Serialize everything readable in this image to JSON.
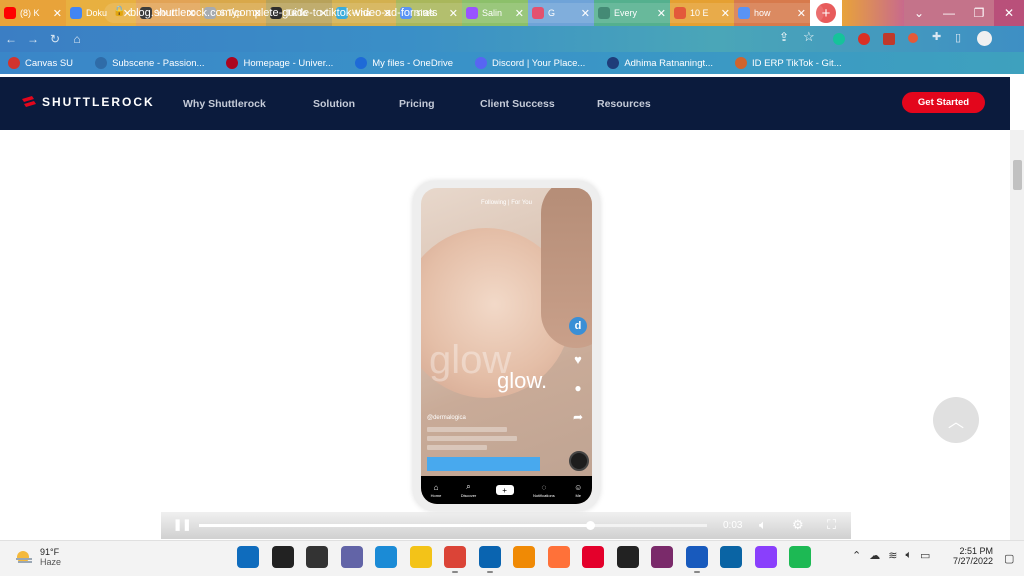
{
  "browser": {
    "tabs": [
      {
        "label": "(8) K",
        "icon": "youtube-icon",
        "color": "#e8a33a",
        "favicon_color": "#ff0000"
      },
      {
        "label": "Doku",
        "icon": "docs-icon",
        "color": "#e8b040",
        "favicon_color": "#4285f4"
      },
      {
        "label": "Your",
        "icon": "notion-icon",
        "color": "#e2a356",
        "favicon_color": "#222222"
      },
      {
        "label": "6 Typ",
        "icon": "page-icon",
        "color": "#d9a84a",
        "favicon_color": "#9aa0a6"
      },
      {
        "label": "TikTo",
        "icon": "tiktok-icon",
        "color": "#b8a25a",
        "favicon_color": "#111111"
      },
      {
        "label": "Wha",
        "icon": "canva-icon",
        "color": "#d3b04f",
        "favicon_color": "#1fa1d6"
      },
      {
        "label": "sites",
        "icon": "google-icon",
        "color": "#a9b75b",
        "favicon_color": "#4285f4"
      },
      {
        "label": "Salin",
        "icon": "canva-icon",
        "color": "#8cc06a",
        "favicon_color": "#8b3dff"
      },
      {
        "label": "G",
        "icon": "tiktok-icon",
        "color": "#6fa3d8",
        "favicon_color": "#e03a5a"
      },
      {
        "label": "Every",
        "icon": "page-icon",
        "color": "#54b08e",
        "favicon_color": "#2b7a62"
      },
      {
        "label": "10 E",
        "icon": "bolt-icon",
        "color": "#e5a032",
        "favicon_color": "#e0431f"
      },
      {
        "label": "how",
        "icon": "google-icon",
        "color": "#d77a4c",
        "favicon_color": "#4285f4"
      }
    ],
    "new_tab": "+",
    "window_controls": {
      "collapse": "⌄",
      "minimize": "—",
      "restore": "❐",
      "close": "✕"
    },
    "url": "blog.shuttlerock.com/complete-guide-to-tiktok-video-ad-formats",
    "bookmarks": [
      {
        "label": "Canvas SU",
        "icon": "canvas-icon",
        "color": "#d1332e"
      },
      {
        "label": "Subscene - Passion...",
        "icon": "subscene-icon",
        "color": "#2f6ca8"
      },
      {
        "label": "Homepage - Univer...",
        "icon": "arizona-icon",
        "color": "#ab0520"
      },
      {
        "label": "My files - OneDrive",
        "icon": "onedrive-icon",
        "color": "#1e6ad7"
      },
      {
        "label": "Discord | Your Place...",
        "icon": "discord-icon",
        "color": "#5865f2"
      },
      {
        "label": "Adhima Ratnaningt...",
        "icon": "grid-icon",
        "color": "#1f3d7a"
      },
      {
        "label": "ID ERP TikTok - Git...",
        "icon": "gitlab-icon",
        "color": "#d0642e"
      }
    ]
  },
  "site": {
    "logo_text": "SHUTTLEROCK",
    "nav": [
      "Why Shuttlerock",
      "Solution",
      "Pricing",
      "Client Success",
      "Resources"
    ],
    "cta": "Get Started",
    "accent": "#e3061c",
    "nav_bg": "#0b1b3d"
  },
  "tiktok_ad": {
    "header": "Following  |  For You",
    "overlay_text_big": "glow",
    "overlay_text_small": "glow.",
    "handle": "@dermalogica",
    "nav": [
      "Home",
      "Discover",
      "",
      "Notifications",
      "Me"
    ],
    "cta_color": "#48a9ee"
  },
  "video": {
    "time": "0:03",
    "progress": 0.77
  },
  "taskbar": {
    "temperature": "91°F",
    "condition": "Haze",
    "time": "2:51 PM",
    "date": "7/27/2022",
    "apps": [
      {
        "icon": "windows-start-icon",
        "color": "#0f6cbd"
      },
      {
        "icon": "search-icon",
        "color": "#222222"
      },
      {
        "icon": "task-view-icon",
        "color": "#333333"
      },
      {
        "icon": "teams-chat-icon",
        "color": "#6264a7"
      },
      {
        "icon": "edge-icon",
        "color": "#1b8bd6"
      },
      {
        "icon": "file-explorer-icon",
        "color": "#f3c318"
      },
      {
        "icon": "chrome-icon",
        "color": "#db4437"
      },
      {
        "icon": "mail-icon",
        "color": "#0a64b0"
      },
      {
        "icon": "vlc-icon",
        "color": "#f08a05"
      },
      {
        "icon": "firefox-icon",
        "color": "#ff7139"
      },
      {
        "icon": "opera-icon",
        "color": "#e4002b"
      },
      {
        "icon": "sticky-notes-icon",
        "color": "#222222"
      },
      {
        "icon": "winrar-icon",
        "color": "#7a2a6a"
      },
      {
        "icon": "word-icon",
        "color": "#185abd"
      },
      {
        "icon": "photos-icon",
        "color": "#0a64a4"
      },
      {
        "icon": "snipping-tool-icon",
        "color": "#8a3ffc"
      },
      {
        "icon": "spotify-icon",
        "color": "#1db954"
      }
    ]
  }
}
